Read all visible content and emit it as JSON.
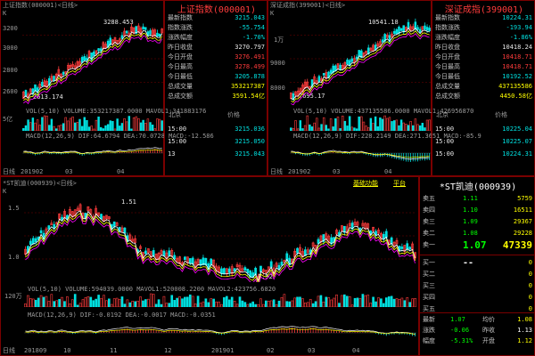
{
  "sh": {
    "tab_label": "上证指数(000001)<日线>",
    "k_label": "K",
    "title": "上证指数(000001)",
    "price_labels": [
      "3200",
      "3000",
      "2800",
      "2600"
    ],
    "peak_label": "3288.453",
    "low_label": "2613.174",
    "vol_axis_label": "5亿",
    "vol_text": "VOL(5,10) VOLUME:353217387.0000 MAVOL1:341883176",
    "macd_text": "MACD(12,26,9) DIF:64.6794 DEA:70.0728 MACD:-12.586",
    "date_labels": [
      "日线",
      "201902",
      "03",
      "04"
    ],
    "info_rows": [
      {
        "k": "最新指数",
        "v": "3215.043",
        "c": "grn"
      },
      {
        "k": "指数涨跌",
        "v": "-55.754",
        "c": "grn"
      },
      {
        "k": "涨跌幅度",
        "v": "-1.70%",
        "c": "grn"
      },
      {
        "k": "昨日收盘",
        "v": "3270.797",
        "c": "wht"
      },
      {
        "k": "今日开盘",
        "v": "3276.491",
        "c": "red"
      },
      {
        "k": "今日最高",
        "v": "3278.499",
        "c": "red"
      },
      {
        "k": "今日最低",
        "v": "3205.878",
        "c": "grn"
      },
      {
        "k": "总成交量",
        "v": "353217387",
        "c": "yel"
      },
      {
        "k": "总成交额",
        "v": "3591.54亿",
        "c": "yel"
      }
    ],
    "list_header": [
      "北京",
      "价格"
    ],
    "list_rows": [
      {
        "time": "15:00",
        "price": "3215.036"
      },
      {
        "time": "15:00",
        "price": "3215.050"
      },
      {
        "time": "13",
        "price": "3215.043"
      }
    ]
  },
  "sz": {
    "tab_label": "深证成指(399001)<日线>",
    "k_label": "K",
    "title": "深证成指(399001)",
    "price_labels": [
      "1万",
      "9000",
      "8000"
    ],
    "peak_label": "10541.18",
    "low_label": "7695.17",
    "vol_text": "VOL(5,10) VOLUME:437135586.0000 MAVOL1:426956870",
    "macd_text": "MACD(12,26,9) DIF:228.2149 DEA:271.3651 MACD:-85.9",
    "date_labels": [
      "日线",
      "201902",
      "03",
      "04"
    ],
    "info_rows": [
      {
        "k": "最新指数",
        "v": "10224.31",
        "c": "grn"
      },
      {
        "k": "指数涨跌",
        "v": "-193.94",
        "c": "grn"
      },
      {
        "k": "涨跌幅度",
        "v": "-1.86%",
        "c": "grn"
      },
      {
        "k": "昨日收盘",
        "v": "10418.24",
        "c": "wht"
      },
      {
        "k": "今日开盘",
        "v": "10418.71",
        "c": "red"
      },
      {
        "k": "今日最高",
        "v": "10418.71",
        "c": "red"
      },
      {
        "k": "今日最低",
        "v": "10192.52",
        "c": "grn"
      },
      {
        "k": "总成交量",
        "v": "437135586",
        "c": "yel"
      },
      {
        "k": "总成交额",
        "v": "4450.58亿",
        "c": "yel"
      }
    ],
    "list_header": [
      "北京",
      "价格"
    ],
    "list_rows": [
      {
        "time": "15:00",
        "price": "10225.04"
      },
      {
        "time": "15:00",
        "price": "10225.07"
      },
      {
        "time": "15:00",
        "price": "10224.31"
      }
    ]
  },
  "st": {
    "tab_label": "*ST凯迪(000939)<日线>",
    "k_label": "K",
    "toolbar_links": [
      "基础功能",
      "平台"
    ],
    "title": "*ST凯迪(000939)",
    "price_labels": [
      "1.5",
      "1.0"
    ],
    "peak_label": "1.51",
    "low_label": "0.92",
    "vol_axis_label": "120万",
    "vol_text": "VOL(5,10) VOLUME:594039.0000 MAVOL1:520008.2200 MAVOL2:423756.6820",
    "macd_text": "MACD(12,26,9) DIF:-0.0192 DEA:-0.0017 MACD:-0.0351",
    "date_labels": [
      "日线",
      "201809",
      "10",
      "11",
      "12",
      "201901",
      "02",
      "03",
      "04"
    ],
    "asks": [
      {
        "label": "卖五",
        "price": "1.11",
        "vol": "5759"
      },
      {
        "label": "卖四",
        "price": "1.10",
        "vol": "16511"
      },
      {
        "label": "卖三",
        "price": "1.09",
        "vol": "29367"
      },
      {
        "label": "卖二",
        "price": "1.08",
        "vol": "29228"
      },
      {
        "label": "卖一",
        "price": "1.07",
        "vol": "47339"
      }
    ],
    "bids": [
      {
        "label": "买一",
        "price": "--",
        "vol": "0"
      },
      {
        "label": "买二",
        "price": "",
        "vol": "0"
      },
      {
        "label": "买三",
        "price": "",
        "vol": "0"
      },
      {
        "label": "买四",
        "price": "",
        "vol": "0"
      },
      {
        "label": "买五",
        "price": "",
        "vol": "0"
      }
    ],
    "stats": [
      {
        "k1": "最新",
        "v1": "1.07",
        "k2": "均价",
        "v2": "1.08"
      },
      {
        "k1": "涨跌",
        "v1": "-0.06",
        "k2": "昨收",
        "v2": "1.13"
      },
      {
        "k1": "幅度",
        "v1": "-5.31%",
        "k2": "开盘",
        "v2": "1.12"
      }
    ]
  },
  "colors": {
    "up": "#ff3c3c",
    "down": "#00e0e0",
    "border": "#7a0000",
    "ma1": "#ffffff",
    "ma2": "#ffff00",
    "ma3": "#ff00ff"
  }
}
